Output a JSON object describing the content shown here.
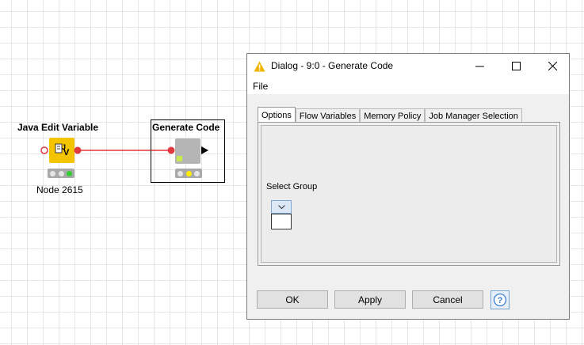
{
  "canvas": {
    "node1": {
      "title": "Java Edit Variable",
      "label": "Node 2615",
      "icon": "java-variable-icon",
      "color": "#f5c400"
    },
    "node2": {
      "title": "Generate Code",
      "color": "#b5b5b5"
    },
    "connection_color": "#e0393e"
  },
  "dialog": {
    "title": "Dialog - 9:0 - Generate Code",
    "menu": {
      "file": "File"
    },
    "tabs": [
      {
        "label": "Options",
        "active": true
      },
      {
        "label": "Flow Variables",
        "active": false
      },
      {
        "label": "Memory Policy",
        "active": false
      },
      {
        "label": "Job Manager Selection",
        "active": false
      }
    ],
    "options": {
      "select_group_label": "Select Group",
      "select_group_value": ""
    },
    "buttons": {
      "ok": "OK",
      "apply": "Apply",
      "cancel": "Cancel"
    },
    "warning_color": "#f0b400"
  }
}
